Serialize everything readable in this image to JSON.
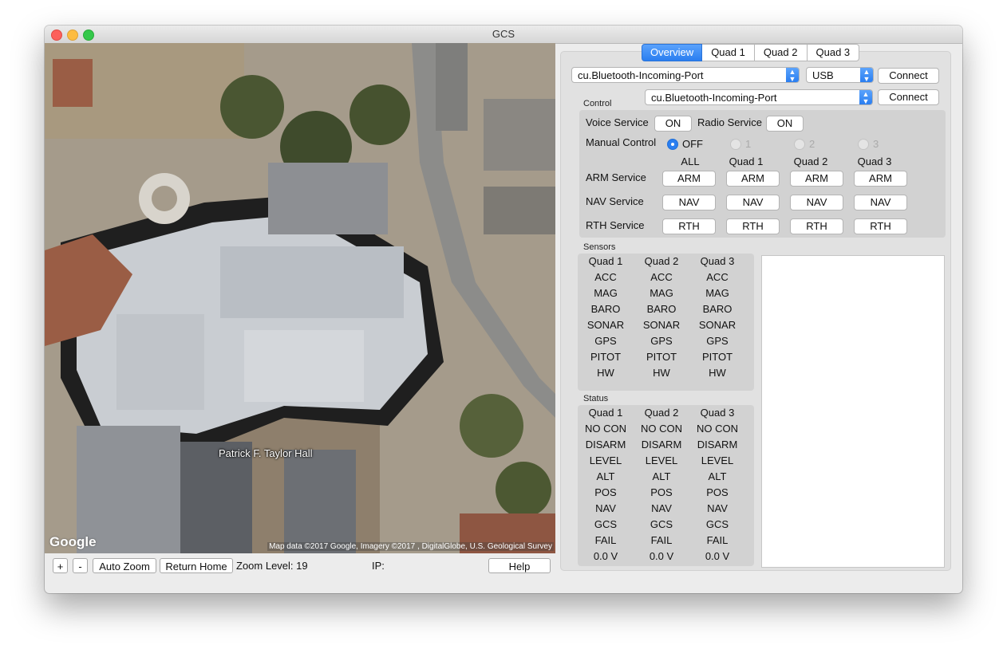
{
  "window": {
    "title": "GCS"
  },
  "map": {
    "place_label": "Patrick F. Taylor Hall",
    "logo": "Google",
    "attribution": "Map data ©2017 Google, Imagery ©2017 , DigitalGlobe, U.S. Geological Survey"
  },
  "mapbar": {
    "zoom_in": "+",
    "zoom_out": "-",
    "auto_zoom": "Auto Zoom",
    "return_home": "Return Home",
    "zoom_level": "Zoom Level: 19",
    "ip_label": "IP:",
    "help": "Help"
  },
  "tabs": [
    "Overview",
    "Quad 1",
    "Quad 2",
    "Quad 3"
  ],
  "connection": {
    "port1": "cu.Bluetooth-Incoming-Port",
    "type": "USB",
    "connect1": "Connect",
    "port2": "cu.Bluetooth-Incoming-Port",
    "connect2": "Connect"
  },
  "control": {
    "label": "Control",
    "voice_service": "Voice Service",
    "voice_value": "ON",
    "radio_service": "Radio Service",
    "radio_value": "ON",
    "manual_control": "Manual Control",
    "radio_options": [
      "OFF",
      "1",
      "2",
      "3"
    ],
    "columns": [
      "ALL",
      "Quad 1",
      "Quad 2",
      "Quad 3"
    ],
    "arm_service": "ARM Service",
    "arm": "ARM",
    "nav_service": "NAV Service",
    "nav": "NAV",
    "rth_service": "RTH Service",
    "rth": "RTH"
  },
  "sensors": {
    "label": "Sensors",
    "headers": [
      "Quad 1",
      "Quad 2",
      "Quad 3"
    ],
    "rows": [
      "ACC",
      "MAG",
      "BARO",
      "SONAR",
      "GPS",
      "PITOT",
      "HW"
    ]
  },
  "status": {
    "label": "Status",
    "headers": [
      "Quad 1",
      "Quad 2",
      "Quad 3"
    ],
    "rows": [
      "NO CON",
      "DISARM",
      "LEVEL",
      "ALT",
      "POS",
      "NAV",
      "GCS",
      "FAIL",
      "0.0 V"
    ]
  },
  "colors": {
    "accent": "#2a7ef0",
    "close": "#fc605b",
    "minimize": "#fdbc40",
    "maximize": "#34c84a"
  }
}
